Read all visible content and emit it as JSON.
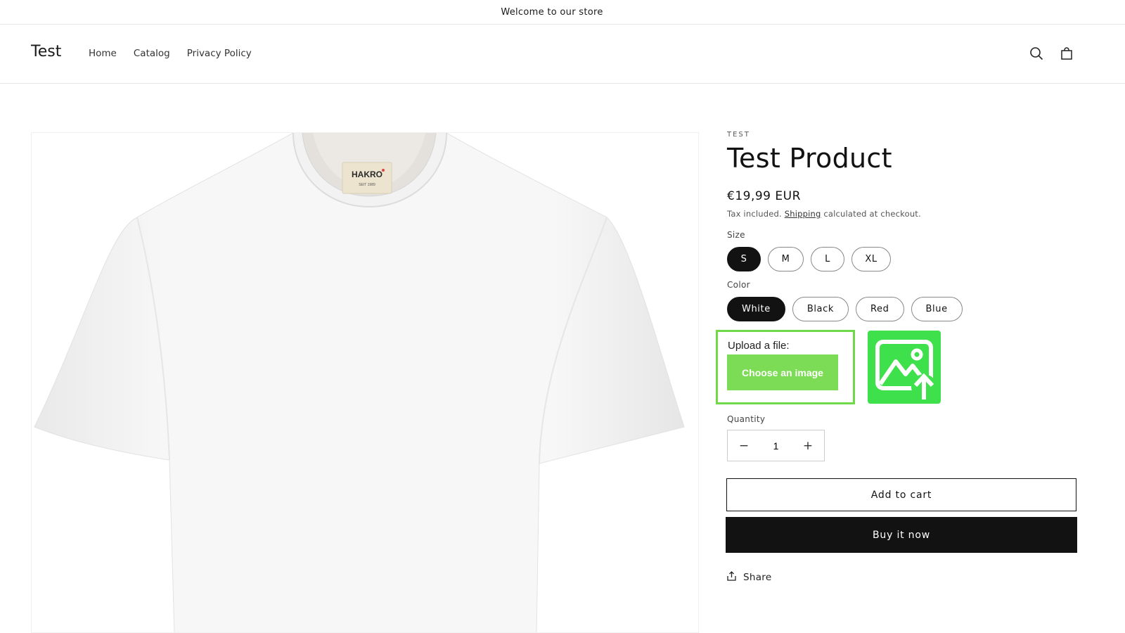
{
  "announcement": "Welcome to our store",
  "header": {
    "logo": "Test",
    "nav": [
      "Home",
      "Catalog",
      "Privacy Policy"
    ],
    "icons": {
      "search": "search-icon",
      "cart": "cart-icon"
    }
  },
  "product": {
    "vendor": "TEST",
    "title": "Test Product",
    "price": "€19,99 EUR",
    "tax_prefix": "Tax included.",
    "tax_link": "Shipping",
    "tax_suffix": "calculated at checkout.",
    "image_label": "HAKRO",
    "image_sublabel": "SEIT 1989"
  },
  "options": {
    "size": {
      "label": "Size",
      "values": [
        "S",
        "M",
        "L",
        "XL"
      ],
      "selected": "S"
    },
    "color": {
      "label": "Color",
      "values": [
        "White",
        "Black",
        "Red",
        "Blue"
      ],
      "selected": "White"
    }
  },
  "upload": {
    "title": "Upload a file:",
    "button": "Choose an image",
    "accent": "#7ddc55",
    "icon": "image-upload-icon"
  },
  "quantity": {
    "label": "Quantity",
    "value": "1",
    "minus": "−",
    "plus": "+"
  },
  "actions": {
    "add_to_cart": "Add to cart",
    "buy_now": "Buy it now",
    "share": "Share"
  }
}
